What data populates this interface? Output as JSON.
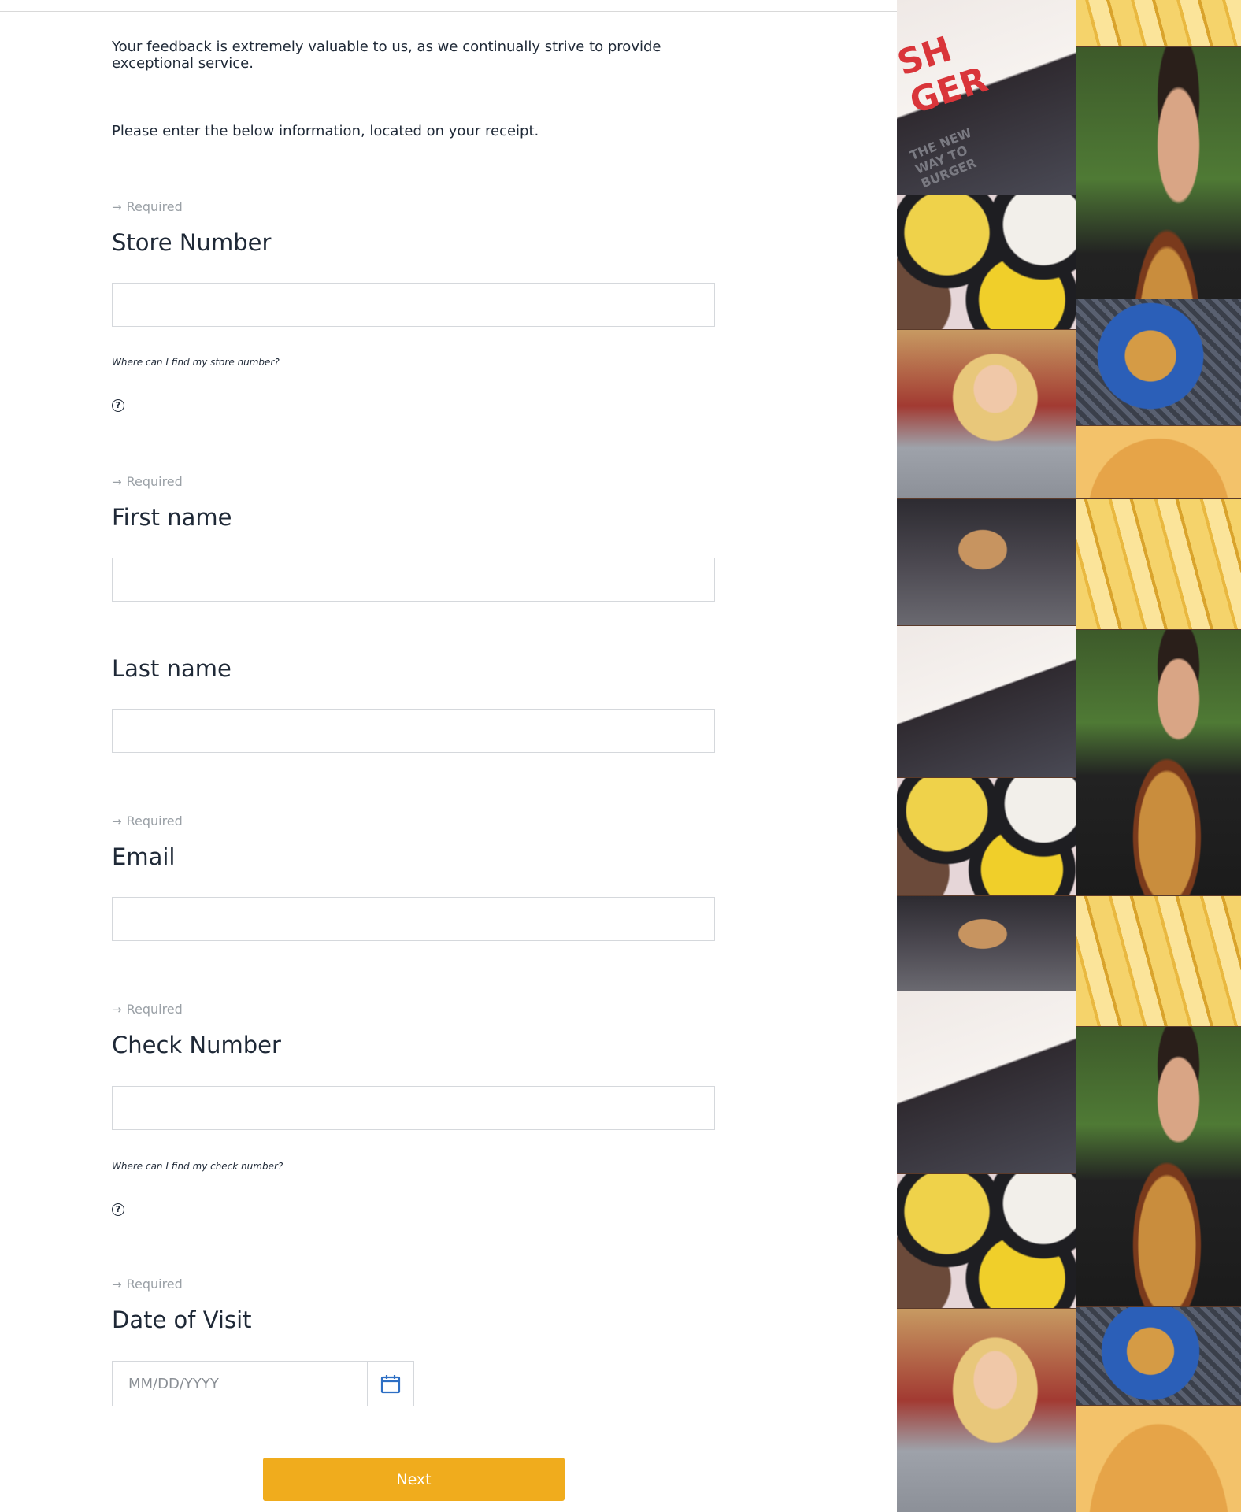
{
  "intro": {
    "feedback_text": "Your feedback is extremely valuable to us, as we continually strive to provide exceptional service.",
    "instruction_text": "Please enter the below information, located on your receipt."
  },
  "form": {
    "required_text": "Required",
    "store_number": {
      "label": "Store Number",
      "value": "",
      "help_text": "Where can I find my store number?"
    },
    "first_name": {
      "label": "First name",
      "value": ""
    },
    "last_name": {
      "label": "Last name",
      "value": ""
    },
    "email": {
      "label": "Email",
      "value": ""
    },
    "check_number": {
      "label": "Check Number",
      "value": "",
      "help_text": "Where can I find my check number?"
    },
    "date_of_visit": {
      "label": "Date of Visit",
      "placeholder": "MM/DD/YYYY",
      "value": ""
    },
    "next_label": "Next"
  },
  "collage": {
    "bag_logo_text": "SH\nGER",
    "bag_sub_text": "THE NEW WAY TO BURGER"
  },
  "colors": {
    "accent": "#f0ac1d",
    "calendar_icon": "#2e6fc4",
    "required_text": "#9aa0a6"
  },
  "icons": {
    "required": "arrow-right-icon",
    "help": "help-circle-icon",
    "date": "calendar-icon"
  }
}
